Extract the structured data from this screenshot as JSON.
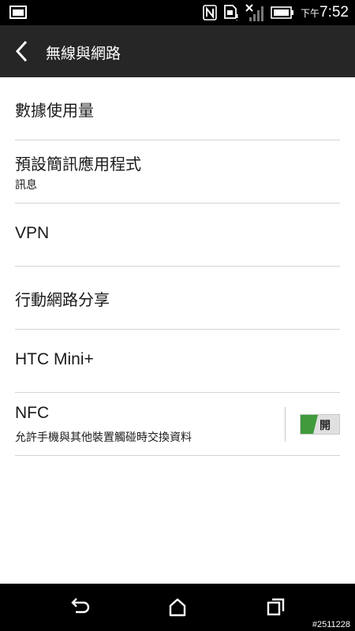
{
  "status_bar": {
    "icons": [
      "gallery-icon",
      "nfc-icon",
      "storage-icon",
      "no-signal-icon",
      "battery-icon"
    ],
    "time_prefix": "下午",
    "time": "7:52"
  },
  "header": {
    "back_icon": "chevron-left-icon",
    "title": "無線與網路"
  },
  "settings": {
    "items": [
      {
        "label": "數據使用量"
      },
      {
        "label": "預設簡訊應用程式",
        "subtitle": "訊息"
      },
      {
        "label": "VPN"
      },
      {
        "label": "行動網路分享"
      },
      {
        "label": "HTC Mini+"
      },
      {
        "label": "NFC",
        "subtitle": "允許手機與其他裝置觸碰時交換資料",
        "toggle": {
          "state": "on",
          "label": "開",
          "color": "#3f9b3c"
        }
      }
    ]
  },
  "nav_bar": {
    "icons": [
      "back-icon",
      "home-icon",
      "recents-icon"
    ],
    "watermark": "#2511228"
  }
}
